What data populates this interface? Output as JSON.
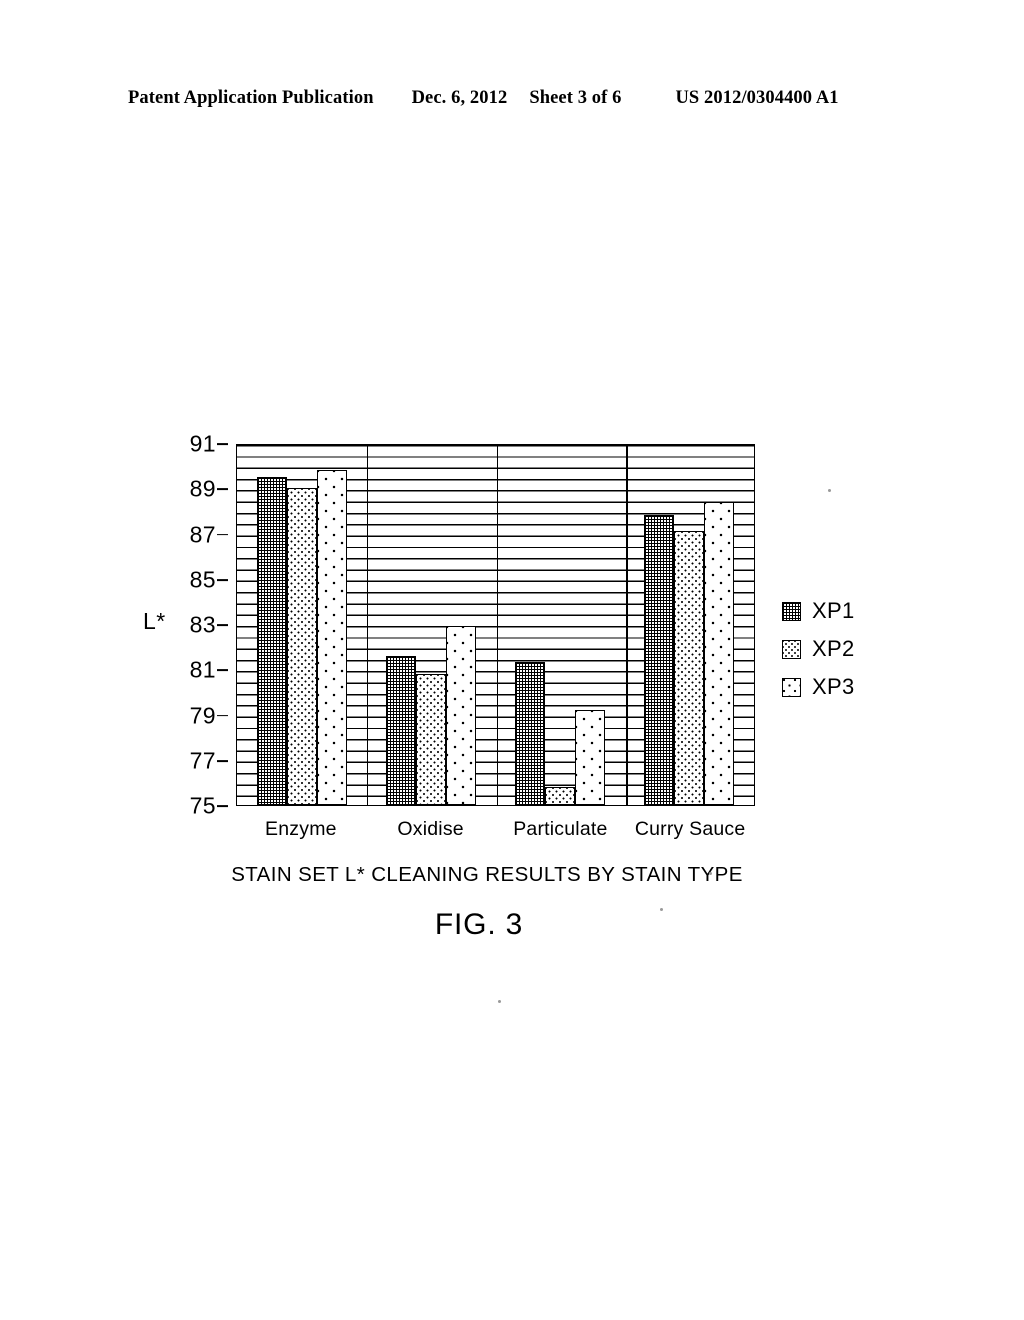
{
  "header": {
    "publication": "Patent Application Publication",
    "date": "Dec. 6, 2012",
    "sheet": "Sheet 3 of 6",
    "number": "US 2012/0304400 A1"
  },
  "figure": {
    "caption": "FIG. 3"
  },
  "chart_data": {
    "type": "bar",
    "title": "STAIN SET L* CLEANING RESULTS BY STAIN TYPE",
    "xlabel": "",
    "ylabel": "L*",
    "ylim": [
      75,
      91
    ],
    "ytick_step": 2,
    "yticks": [
      91,
      89,
      87,
      85,
      83,
      81,
      79,
      77,
      75
    ],
    "ytick_labels": [
      "91",
      "89",
      "87",
      "85",
      "83",
      "81",
      "79",
      "77",
      "75"
    ],
    "minor_gridline_step": 0.5,
    "grid": true,
    "grid_orientation": "horizontal",
    "legend_position": "right",
    "categories": [
      "Enzyme",
      "Oxidise",
      "Particulate",
      "Curry Sauce"
    ],
    "series": [
      {
        "name": "XP1",
        "fill": "dense-hatch",
        "values": [
          89.5,
          81.6,
          81.3,
          87.8
        ]
      },
      {
        "name": "XP2",
        "fill": "medium-dots",
        "values": [
          89.0,
          80.8,
          75.8,
          87.1
        ]
      },
      {
        "name": "XP3",
        "fill": "sparse-dots",
        "values": [
          89.8,
          82.9,
          79.2,
          88.4
        ]
      }
    ]
  }
}
